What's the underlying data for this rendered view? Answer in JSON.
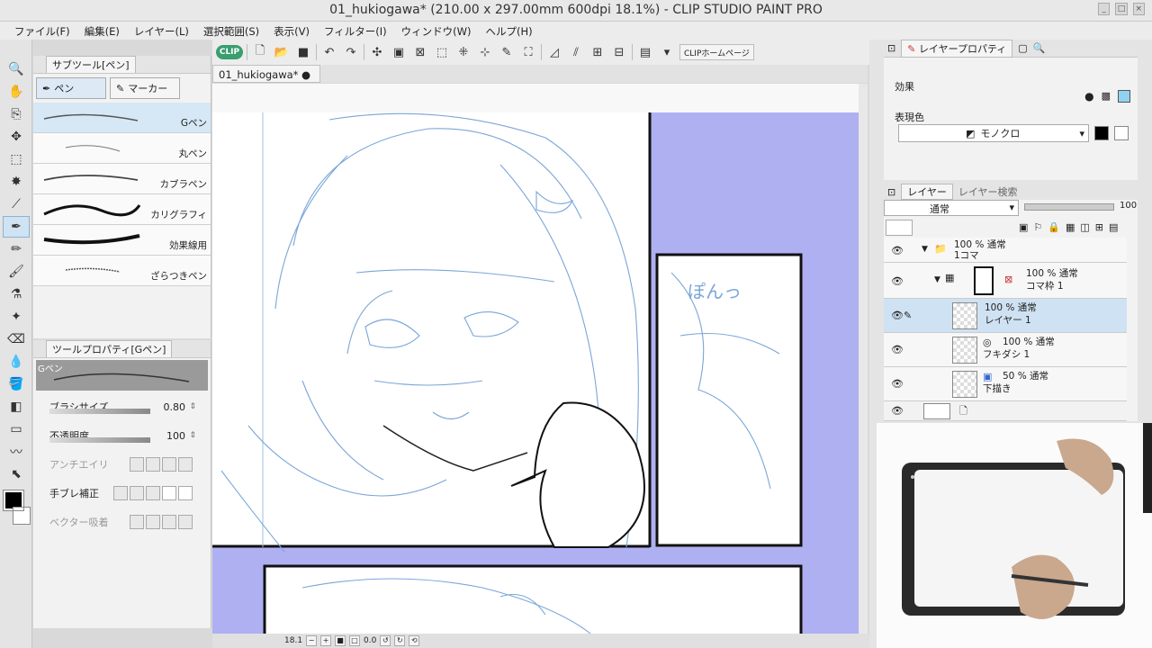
{
  "window": {
    "title": "01_hukiogawa* (210.00 x 297.00mm 600dpi 18.1%)  - CLIP STUDIO PAINT PRO"
  },
  "menu": [
    "ファイル(F)",
    "編集(E)",
    "レイヤー(L)",
    "選択範囲(S)",
    "表示(V)",
    "フィルター(I)",
    "ウィンドウ(W)",
    "ヘルプ(H)"
  ],
  "command_bar": {
    "clip_label": "CLIP",
    "home_label": "CLIPホームページ"
  },
  "subtool": {
    "header": "サブツール[ペン]",
    "groups": [
      "ペン",
      "マーカー"
    ],
    "brushes": [
      "Gペン",
      "丸ペン",
      "カブラペン",
      "カリグラフィ",
      "効果線用",
      "ざらつきペン"
    ]
  },
  "tool_property": {
    "header": "ツールプロパティ[Gペン]",
    "preview_name": "Gペン",
    "brush_size_label": "ブラシサイズ",
    "brush_size_value": "0.80",
    "opacity_label": "不透明度",
    "opacity_value": "100",
    "antialias_label": "アンチエイリ",
    "stabilize_label": "手ブレ補正",
    "vector_label": "ベクター吸着"
  },
  "canvas": {
    "doc_tab": "01_hukiogawa*",
    "lettering": "ぽんっ"
  },
  "status": {
    "zoom": "18.1",
    "angle": "0.0"
  },
  "layer_property": {
    "header": "レイヤープロパティ",
    "effect_label": "効果",
    "express_label": "表現色",
    "express_value": "モノクロ"
  },
  "layers": {
    "tab_layer": "レイヤー",
    "tab_search": "レイヤー検索",
    "blend_mode": "通常",
    "opacity": "100",
    "rows": [
      {
        "opacity": "100 % 通常",
        "name": "1コマ"
      },
      {
        "opacity": "100 % 通常",
        "name": "コマ枠 1"
      },
      {
        "opacity": "100 % 通常",
        "name": "レイヤー 1"
      },
      {
        "opacity": "100 % 通常",
        "name": "フキダシ 1"
      },
      {
        "opacity": "50 % 通常",
        "name": "下描き"
      }
    ]
  },
  "colors": {
    "accent": "#3a9e6e",
    "selection": "#cfe2f3",
    "canvas_bg": "#aeb0f2",
    "sketch": "#7aa6d8"
  }
}
